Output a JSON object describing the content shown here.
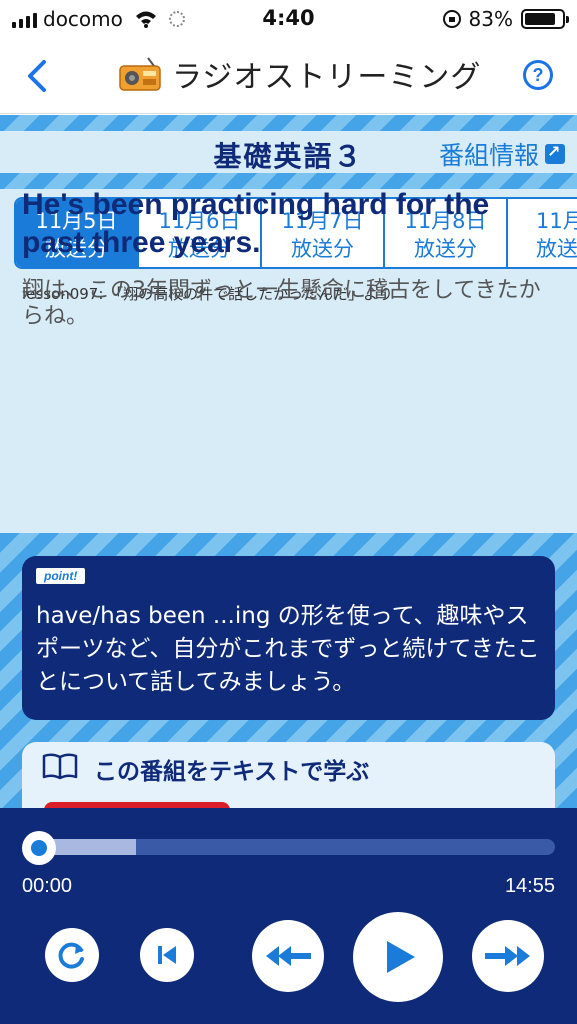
{
  "status_bar": {
    "carrier": "docomo",
    "time": "4:40",
    "battery": "83%",
    "battery_level": 0.83
  },
  "nav": {
    "title": "ラジオストリーミング",
    "help": "?"
  },
  "program": {
    "title": "基礎英語３",
    "info_link": "番組情報"
  },
  "date_tabs": [
    {
      "date": "11月5日",
      "label": "放送分",
      "active": true
    },
    {
      "date": "11月6日",
      "label": "放送分",
      "active": false
    },
    {
      "date": "11月7日",
      "label": "放送分",
      "active": false
    },
    {
      "date": "11月8日",
      "label": "放送分",
      "active": false
    },
    {
      "date": "11月",
      "label": "放送",
      "active": false
    }
  ],
  "lesson": {
    "line": "lesson097: 「翔の高校の件で話したかったんだ」より",
    "english": "He's been practicing hard for the past three years.",
    "japanese": "翔は、この3年間ずっと一生懸命に稽古をしてきたからね。"
  },
  "point": {
    "badge": "point!",
    "text": "have/has been ...ing の形を使って、趣味やスポーツなど、自分がこれまでずっと続けてきたことについて話してみましょう。"
  },
  "study": {
    "label": "この番組をテキストで学ぶ"
  },
  "player": {
    "current_time": "00:00",
    "total_time": "14:55",
    "buffered_fraction": 0.21,
    "position_fraction": 0.0
  },
  "colors": {
    "accent": "#1a7bd8",
    "navy": "#0e2a78",
    "light_bg": "#d8ecf8"
  }
}
